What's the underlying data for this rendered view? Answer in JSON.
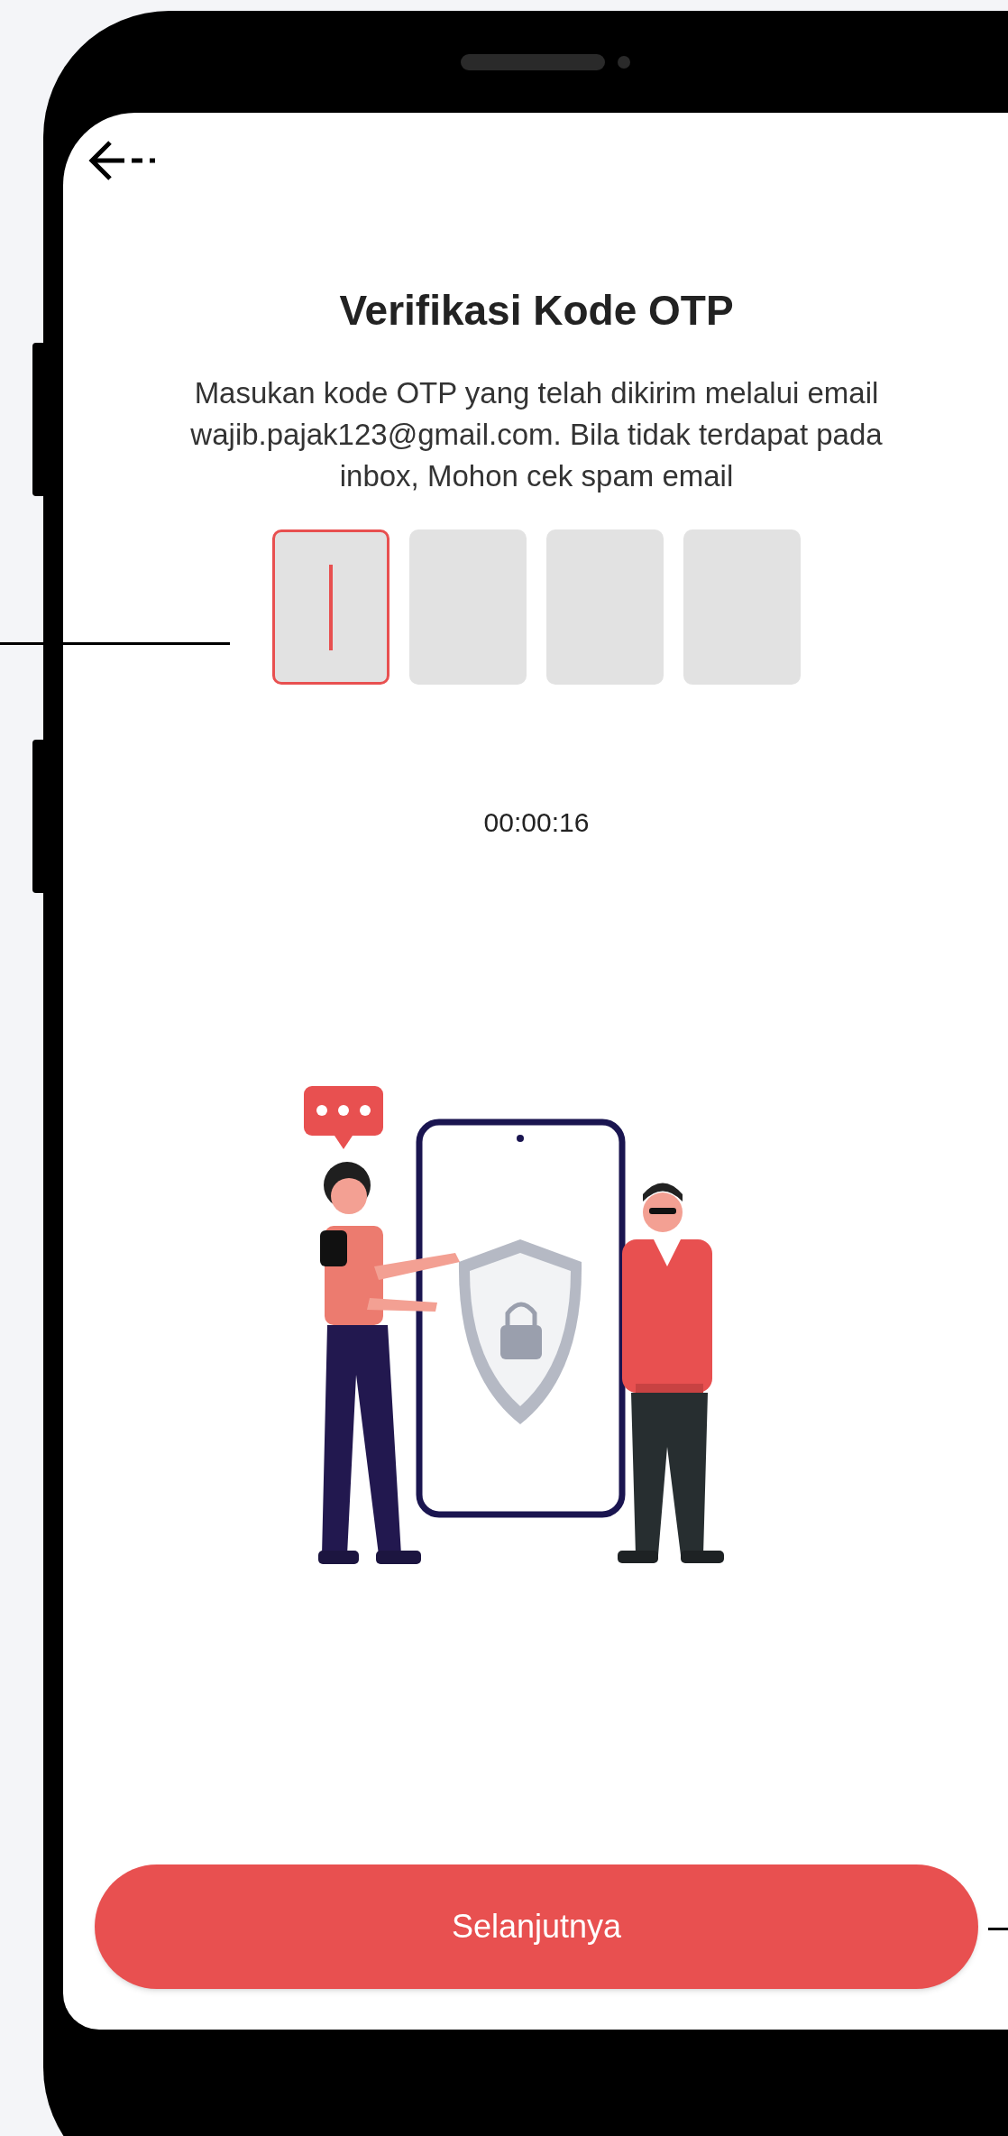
{
  "screen": {
    "title": "Verifikasi Kode OTP",
    "description": "Masukan kode OTP yang telah dikirim melalui email wajib.pajak123@gmail.com. Bila tidak terdapat pada inbox, Mohon cek spam email",
    "otp_boxes": [
      {
        "selected": true
      },
      {
        "selected": false
      },
      {
        "selected": false
      },
      {
        "selected": false
      }
    ],
    "timer": "00:00:16",
    "button": "Selanjutnya"
  }
}
